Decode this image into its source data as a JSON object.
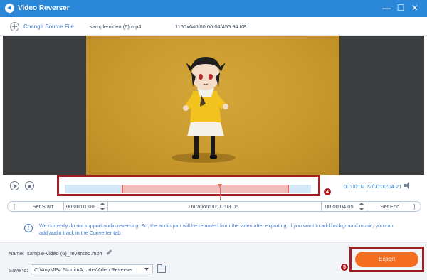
{
  "titlebar": {
    "title": "Video Reverser",
    "minimize_symbol": "—",
    "maximize_symbol": "☐",
    "close_symbol": "✕"
  },
  "toolbar": {
    "change_source_label": "Change Source File",
    "file_name": "sample-video (6).mp4",
    "file_meta": "1150x640/00:00:04/455.94 KB"
  },
  "player": {
    "time_readout": "00:00:02.22/00:00:04.21",
    "selection_start_fraction": 0.23,
    "selection_end_fraction": 0.91,
    "playhead_fraction": 0.63
  },
  "annotations": {
    "step4": "4",
    "step5": "5"
  },
  "trim": {
    "left_bracket": "[",
    "right_bracket": "]",
    "set_start_label": "Set Start",
    "start_time": "00:00:01.00",
    "duration": "Duration:00:00:03.05",
    "end_time": "00:00:04.05",
    "set_end_label": "Set End"
  },
  "notice": {
    "icon_glyph": "!",
    "text": "We currently do not support audio reversing. So, the audio part will be removed from the video after exporting. If you want to add background music, you can add audio track in the Converter tab."
  },
  "output": {
    "name_label": "Name:",
    "name_value": "sample-video (6)_reversed.mp4",
    "save_label": "Save to:",
    "save_path": "C:\\AnyMP4 Studio\\A...ate\\Video Reverser",
    "export_label": "Export"
  },
  "colors": {
    "titlebar": "#2a86d7",
    "accent_blue": "#2f80d0",
    "export_orange": "#f36f1f",
    "highlight_red": "#a31e22",
    "selection_pink": "#f0bcbc",
    "track_blue": "#d4e8f8"
  },
  "icons": [
    "app-icon",
    "minimize-icon",
    "maximize-icon",
    "close-icon",
    "plus-icon",
    "play-icon",
    "stop-icon",
    "volume-icon",
    "stepper-icon",
    "info-icon",
    "pencil-icon",
    "dropdown-icon",
    "folder-icon"
  ]
}
